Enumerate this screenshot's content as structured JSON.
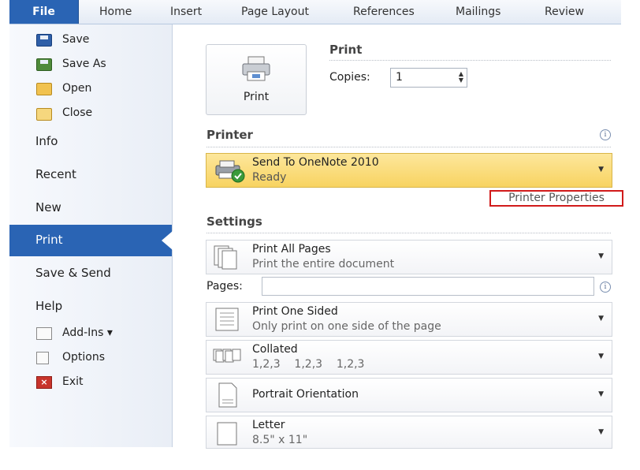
{
  "ribbon": {
    "tabs": [
      "File",
      "Home",
      "Insert",
      "Page Layout",
      "References",
      "Mailings",
      "Review"
    ]
  },
  "nav": {
    "save": "Save",
    "save_as": "Save As",
    "open": "Open",
    "close": "Close",
    "info": "Info",
    "recent": "Recent",
    "new": "New",
    "print": "Print",
    "save_send": "Save & Send",
    "help": "Help",
    "add_ins": "Add-Ins ▾",
    "options": "Options",
    "exit": "Exit"
  },
  "print_section": {
    "button_label": "Print",
    "title": "Print",
    "copies_label": "Copies:",
    "copies_value": "1"
  },
  "printer": {
    "title": "Printer",
    "name": "Send To OneNote 2010",
    "status": "Ready",
    "properties_link": "Printer Properties"
  },
  "settings": {
    "title": "Settings",
    "range_title": "Print All Pages",
    "range_desc": "Print the entire document",
    "pages_label": "Pages:",
    "pages_value": "",
    "sides_title": "Print One Sided",
    "sides_desc": "Only print on one side of the page",
    "collate_title": "Collated",
    "collate_desc": "1,2,3    1,2,3    1,2,3",
    "orientation": "Portrait Orientation",
    "paper_title": "Letter",
    "paper_desc": "8.5\" x 11\""
  },
  "colors": {
    "file_tab": "#2a64b4",
    "selected_nav": "#2a64b4",
    "printer_highlight": "#f8d361",
    "annotation_box": "#d11b1b"
  }
}
